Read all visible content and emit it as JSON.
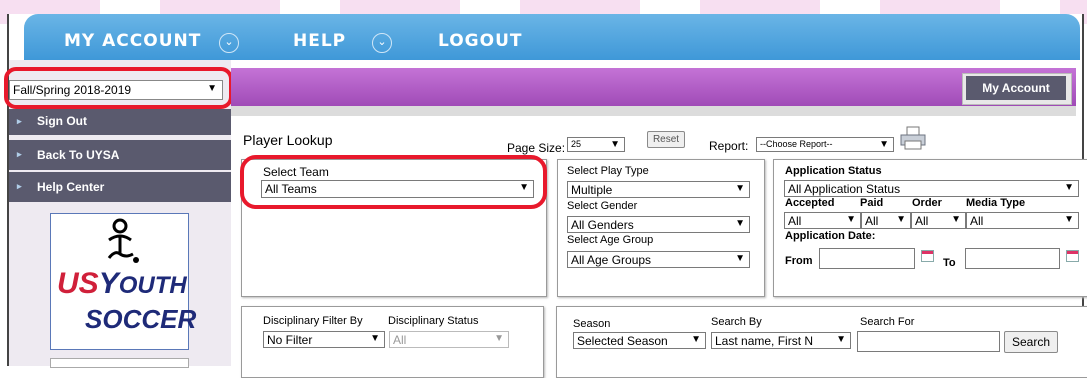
{
  "nav": {
    "my_account": "MY ACCOUNT",
    "help": "HELP",
    "logout": "LOGOUT",
    "dropdown_glyph": "⌄"
  },
  "sidebar": {
    "season_select": {
      "value": "Fall/Spring 2018-2019",
      "arrow": "▼"
    },
    "items": [
      {
        "label": "Sign Out",
        "caret": "▸"
      },
      {
        "label": "Back To UYSA",
        "caret": "▸"
      },
      {
        "label": "Help Center",
        "caret": "▸"
      }
    ],
    "logo": {
      "line1": "US",
      "line2": "OUTH",
      "line3": "SOCCER",
      "mark": "Y"
    }
  },
  "header": {
    "my_account_button": "My Account"
  },
  "lookup": {
    "title": "Player Lookup",
    "page_size_label": "Page Size:",
    "page_size_value": "25",
    "reset_label": "Reset",
    "report_label": "Report:",
    "report_value": "--Choose Report--"
  },
  "team": {
    "label": "Select Team",
    "value": "All Teams"
  },
  "play": {
    "play_type_label": "Select Play Type",
    "play_type_value": "Multiple",
    "gender_label": "Select Gender",
    "gender_value": "All Genders",
    "age_label": "Select Age Group",
    "age_value": "All Age Groups"
  },
  "application": {
    "status_label": "Application Status",
    "status_value": "All Application Status",
    "accepted_label": "Accepted",
    "paid_label": "Paid",
    "order_label": "Order",
    "media_label": "Media Type",
    "accepted_value": "All",
    "paid_value": "All",
    "order_value": "All",
    "media_value": "All",
    "date_label": "Application Date:",
    "from_label": "From",
    "to_label": "To"
  },
  "discipline": {
    "filter_label": "Disciplinary Filter By",
    "status_label": "Disciplinary Status",
    "filter_value": "No Filter",
    "status_value": "All"
  },
  "search": {
    "season_label": "Season",
    "season_value": "Selected Season",
    "by_label": "Search By",
    "by_value": "Last name, First N",
    "for_label": "Search For",
    "for_value": "",
    "button": "Search"
  },
  "colors": {
    "nav_blue": "#4fa6df",
    "header_purple": "#b35fc8",
    "sidebar_dark": "#5a5a6e",
    "highlight_red": "#e8192c"
  }
}
